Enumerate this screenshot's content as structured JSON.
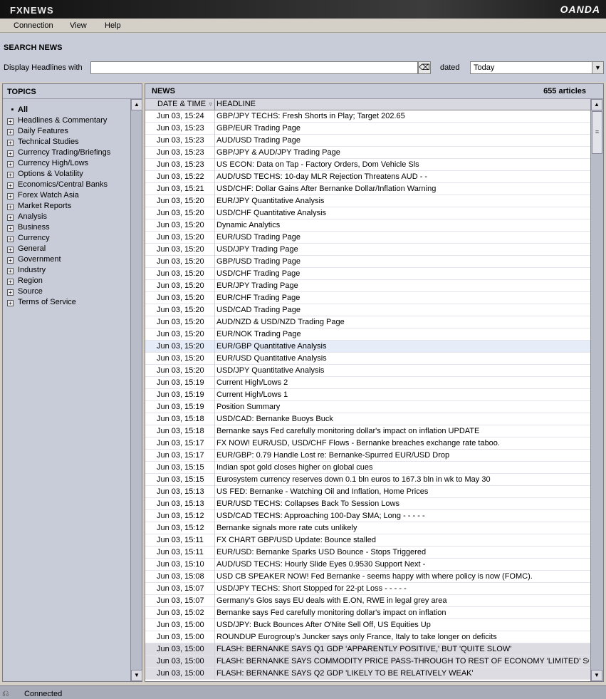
{
  "titlebar": {
    "logo": "FXNEWS",
    "brand": "OANDA"
  },
  "menu": [
    "Connection",
    "View",
    "Help"
  ],
  "search": {
    "title": "SEARCH NEWS",
    "display_label": "Display Headlines with",
    "input_value": "",
    "dated_label": "dated",
    "dated_value": "Today"
  },
  "topics": {
    "header": "TOPICS",
    "all_label": "All",
    "items": [
      "Headlines & Commentary",
      "Daily Features",
      "Technical Studies",
      "Currency Trading/Briefings",
      "Currency High/Lows",
      "Options & Volatility",
      "Economics/Central Banks",
      "Forex Watch Asia",
      "Market Reports",
      "Analysis",
      "Business",
      "Currency",
      "General",
      "Government",
      "Industry",
      "Region",
      "Source",
      "Terms of Service"
    ]
  },
  "news": {
    "header": "NEWS",
    "count": "655 articles",
    "col_date": "DATE & TIME",
    "col_headline": "HEADLINE",
    "rows": [
      {
        "d": "Jun 03, 15:24",
        "h": "GBP/JPY TECHS: Fresh Shorts in Play; Target 202.65"
      },
      {
        "d": "Jun 03, 15:23",
        "h": "GBP/EUR Trading Page"
      },
      {
        "d": "Jun 03, 15:23",
        "h": "AUD/USD Trading Page"
      },
      {
        "d": "Jun 03, 15:23",
        "h": "GBP/JPY & AUD/JPY Trading Page"
      },
      {
        "d": "Jun 03, 15:23",
        "h": "US ECON: Data on Tap - Factory Orders, Dom Vehicle Sls"
      },
      {
        "d": "Jun 03, 15:22",
        "h": "AUD/USD TECHS: 10-day MLR Rejection Threatens AUD - -"
      },
      {
        "d": "Jun 03, 15:21",
        "h": "USD/CHF: Dollar Gains After Bernanke Dollar/Inflation Warning"
      },
      {
        "d": "Jun 03, 15:20",
        "h": "EUR/JPY Quantitative Analysis"
      },
      {
        "d": "Jun 03, 15:20",
        "h": "USD/CHF Quantitative Analysis"
      },
      {
        "d": "Jun 03, 15:20",
        "h": "Dynamic Analytics"
      },
      {
        "d": "Jun 03, 15:20",
        "h": "EUR/USD Trading Page"
      },
      {
        "d": "Jun 03, 15:20",
        "h": "USD/JPY Trading Page"
      },
      {
        "d": "Jun 03, 15:20",
        "h": "GBP/USD Trading Page"
      },
      {
        "d": "Jun 03, 15:20",
        "h": "USD/CHF Trading Page"
      },
      {
        "d": "Jun 03, 15:20",
        "h": "EUR/JPY Trading Page"
      },
      {
        "d": "Jun 03, 15:20",
        "h": "EUR/CHF Trading Page"
      },
      {
        "d": "Jun 03, 15:20",
        "h": "USD/CAD Trading Page"
      },
      {
        "d": "Jun 03, 15:20",
        "h": "AUD/NZD & USD/NZD Trading Page"
      },
      {
        "d": "Jun 03, 15:20",
        "h": "EUR/NOK Trading Page"
      },
      {
        "d": "Jun 03, 15:20",
        "h": "EUR/GBP Quantitative Analysis"
      },
      {
        "d": "Jun 03, 15:20",
        "h": "EUR/USD Quantitative Analysis"
      },
      {
        "d": "Jun 03, 15:20",
        "h": "USD/JPY Quantitative Analysis"
      },
      {
        "d": "Jun 03, 15:19",
        "h": "Current High/Lows 2"
      },
      {
        "d": "Jun 03, 15:19",
        "h": "Current High/Lows 1"
      },
      {
        "d": "Jun 03, 15:19",
        "h": "Position Summary"
      },
      {
        "d": "Jun 03, 15:18",
        "h": "USD/CAD: Bernanke Buoys Buck"
      },
      {
        "d": "Jun 03, 15:18",
        "h": "Bernanke says Fed carefully monitoring dollar's impact on inflation UPDATE"
      },
      {
        "d": "Jun 03, 15:17",
        "h": "FX NOW! EUR/USD, USD/CHF Flows - Bernanke breaches exchange rate taboo."
      },
      {
        "d": "Jun 03, 15:17",
        "h": "EUR/GBP: 0.79 Handle Lost re: Bernanke-Spurred EUR/USD Drop"
      },
      {
        "d": "Jun 03, 15:15",
        "h": "Indian spot gold closes higher on global cues"
      },
      {
        "d": "Jun 03, 15:15",
        "h": "Eurosystem currency reserves down 0.1 bln euros to 167.3 bln in wk to May 30"
      },
      {
        "d": "Jun 03, 15:13",
        "h": "US FED: Bernanke - Watching Oil and Inflation, Home Prices"
      },
      {
        "d": "Jun 03, 15:13",
        "h": "EUR/USD TECHS: Collapses Back To Session Lows"
      },
      {
        "d": "Jun 03, 15:12",
        "h": "USD/CAD TECHS: Approaching 100-Day SMA; Long - - - - -"
      },
      {
        "d": "Jun 03, 15:12",
        "h": "Bernanke signals more rate cuts unlikely"
      },
      {
        "d": "Jun 03, 15:11",
        "h": "FX CHART GBP/USD Update: Bounce stalled"
      },
      {
        "d": "Jun 03, 15:11",
        "h": "EUR/USD: Bernanke Sparks USD Bounce - Stops Triggered"
      },
      {
        "d": "Jun 03, 15:10",
        "h": "AUD/USD TECHS: Hourly Slide Eyes 0.9530 Support Next -"
      },
      {
        "d": "Jun 03, 15:08",
        "h": "USD CB SPEAKER NOW! Fed Bernanke - seems happy with where policy is now (FOMC)."
      },
      {
        "d": "Jun 03, 15:07",
        "h": "USD/JPY TECHS: Short Stopped for 22-pt Loss - - - - -"
      },
      {
        "d": "Jun 03, 15:07",
        "h": "Germany's Glos says EU deals with E.ON, RWE in legal grey area"
      },
      {
        "d": "Jun 03, 15:02",
        "h": "Bernanke says Fed carefully monitoring dollar's impact on inflation"
      },
      {
        "d": "Jun 03, 15:00",
        "h": "USD/JPY: Buck Bounces After O'Nite Sell Off, US Equities Up"
      },
      {
        "d": "Jun 03, 15:00",
        "h": "ROUNDUP Eurogroup's Juncker says only France, Italy to take longer on deficits"
      },
      {
        "d": "Jun 03, 15:00",
        "h": "FLASH: BERNANKE SAYS Q1 GDP 'APPARENTLY POSITIVE,' BUT 'QUITE SLOW'"
      },
      {
        "d": "Jun 03, 15:00",
        "h": "FLASH: BERNANKE SAYS COMMODITY PRICE PASS-THROUGH TO REST OF ECONOMY 'LIMITED' SO FAR"
      },
      {
        "d": "Jun 03, 15:00",
        "h": "FLASH: BERNANKE SAYS Q2 GDP 'LIKELY TO BE RELATIVELY WEAK'"
      }
    ],
    "selected_index": 19,
    "flash_from_index": 44
  },
  "status": {
    "text": "Connected"
  }
}
